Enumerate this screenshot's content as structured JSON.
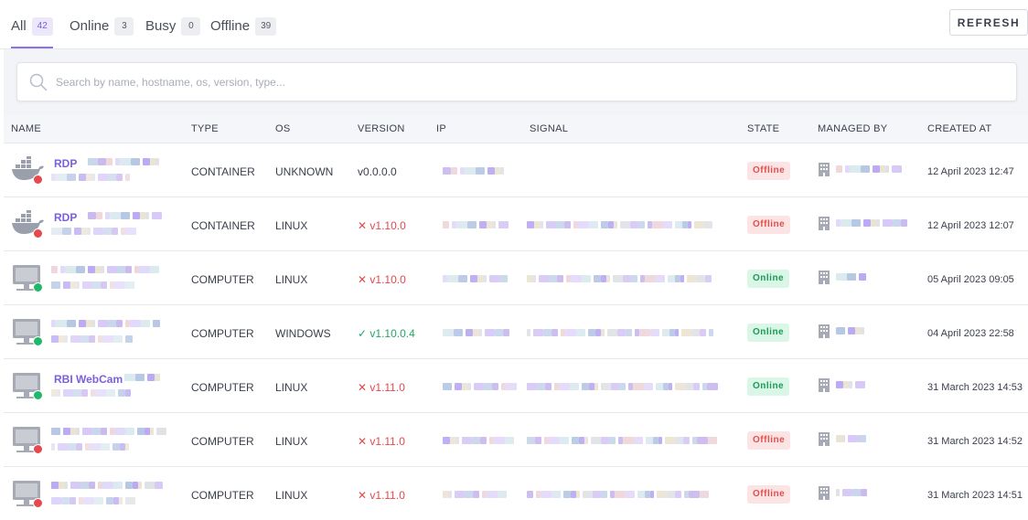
{
  "tabs": [
    {
      "label": "All",
      "count": "42",
      "active": true
    },
    {
      "label": "Online",
      "count": "3",
      "active": false
    },
    {
      "label": "Busy",
      "count": "0",
      "active": false
    },
    {
      "label": "Offline",
      "count": "39",
      "active": false
    }
  ],
  "refresh_label": "REFRESH",
  "search": {
    "placeholder": "Search by name, hostname, os, version, type..."
  },
  "columns": {
    "name": "NAME",
    "type": "TYPE",
    "os": "OS",
    "version": "VERSION",
    "ip": "IP",
    "signal": "SIGNAL",
    "state": "STATE",
    "managed_by": "MANAGED BY",
    "created_at": "CREATED AT"
  },
  "colors": {
    "accent": "#8c72ea",
    "offline": "#e5484d",
    "online": "#1fb86a"
  },
  "rows": [
    {
      "icon": "docker-icon",
      "status": "offline",
      "name": "RDP",
      "type": "CONTAINER",
      "os": "UNKNOWN",
      "version": "v0.0.0.0",
      "version_status": "plain",
      "state": "Offline",
      "created": "12 April 2023 12:47"
    },
    {
      "icon": "docker-icon",
      "status": "offline",
      "name": "RDP",
      "type": "CONTAINER",
      "os": "LINUX",
      "version": "v1.10.0",
      "version_status": "bad",
      "state": "Offline",
      "created": "12 April 2023 12:07"
    },
    {
      "icon": "computer-icon",
      "status": "online",
      "name": "",
      "type": "COMPUTER",
      "os": "LINUX",
      "version": "v1.10.0",
      "version_status": "bad",
      "state": "Online",
      "created": "05 April 2023 09:05"
    },
    {
      "icon": "computer-icon",
      "status": "online",
      "name": "",
      "type": "COMPUTER",
      "os": "WINDOWS",
      "version": "v1.10.0.4",
      "version_status": "ok",
      "state": "Online",
      "created": "04 April 2023 22:58"
    },
    {
      "icon": "computer-icon",
      "status": "online",
      "name": "RBI WebCam",
      "type": "COMPUTER",
      "os": "LINUX",
      "version": "v1.11.0",
      "version_status": "bad",
      "state": "Online",
      "created": "31 March 2023 14:53"
    },
    {
      "icon": "computer-icon",
      "status": "offline",
      "name": "",
      "type": "COMPUTER",
      "os": "LINUX",
      "version": "v1.11.0",
      "version_status": "bad",
      "state": "Offline",
      "created": "31 March 2023 14:52"
    },
    {
      "icon": "computer-icon",
      "status": "offline",
      "name": "",
      "type": "COMPUTER",
      "os": "LINUX",
      "version": "v1.11.0",
      "version_status": "bad",
      "state": "Offline",
      "created": "31 March 2023 14:51"
    }
  ]
}
